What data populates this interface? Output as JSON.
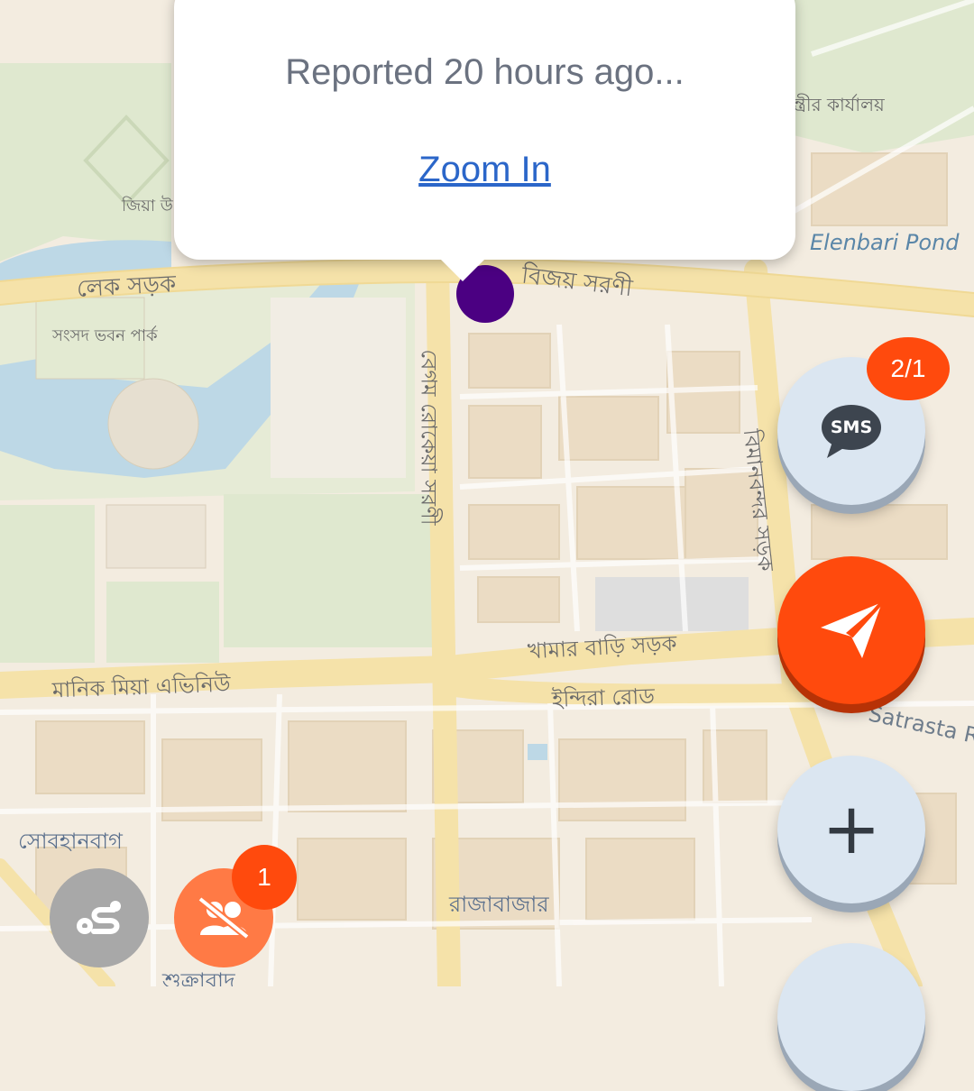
{
  "popup": {
    "report_text": "Reported 20 hours ago...",
    "zoom_link": "Zoom In"
  },
  "map": {
    "labels": {
      "lake_road": "লেক সড়ক",
      "bijoy_sarani": "বিজয় সরণী",
      "park": "সংসদ ভবন পার্ক",
      "zia": "জিয়া উ",
      "begum_rokeya": "বেগম রোকেয়া সরণী",
      "bimanbandar": "বিমানবন্দর সড়ক",
      "khamar_bari": "খামার বাড়ি সড়ক",
      "manik_mia": "মানিক মিয়া এভিনিউ",
      "indira_road": "ইন্দিরা রোড",
      "sobhanbag": "সোবহানবাগ",
      "rajabazar": "রাজাবাজার",
      "shukrabad": "শুক্রাবাদ",
      "karyalay": "ন্ত্রীর কার্যালয়",
      "elenbari": "Elenbari Pond",
      "satrasta": "Satrasta R"
    }
  },
  "controls": {
    "sms_label": "SMS",
    "sms_badge": "2/1",
    "crowd_badge": "1",
    "plus_symbol": "+"
  },
  "colors": {
    "accent_orange": "#ff4a0d",
    "marker_purple": "#4b0082",
    "fab_blue": "#dbe6f1",
    "link_blue": "#2b66c9"
  }
}
